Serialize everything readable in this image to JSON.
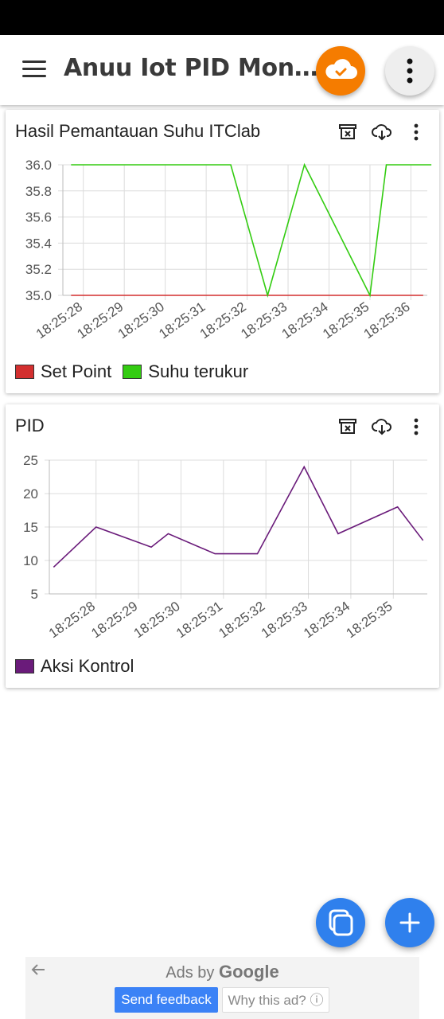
{
  "header": {
    "title": "Anuu Iot PID Mon…",
    "menu_icon": "menu-icon",
    "cloud_icon": "cloud-check-icon",
    "more_icon": "more-vert-icon",
    "accent": "#f57c00"
  },
  "cards": [
    {
      "title": "Hasil Pemantauan Suhu ITClab",
      "icons": [
        "archive-delete-icon",
        "cloud-download-icon",
        "more-vert-icon"
      ]
    },
    {
      "title": "PID",
      "icons": [
        "archive-delete-icon",
        "cloud-download-icon",
        "more-vert-icon"
      ]
    }
  ],
  "chart_data": [
    {
      "type": "line",
      "x_ticks": [
        "18:25:28",
        "18:25:29",
        "18:25:30",
        "18:25:31",
        "18:25:32",
        "18:25:33",
        "18:25:34",
        "18:25:35",
        "18:25:36"
      ],
      "y_ticks": [
        "36.0",
        "35.8",
        "35.6",
        "35.4",
        "35.2",
        "35.0"
      ],
      "ylim": [
        35.0,
        36.0
      ],
      "grid": true,
      "legend_position": "bottom",
      "series": [
        {
          "name": "Set Point",
          "color": "#d32f2f",
          "points": [
            [
              27.7,
              35.0
            ],
            [
              36.3,
              35.0
            ]
          ]
        },
        {
          "name": "Suhu terukur",
          "color": "#33cc11",
          "points": [
            [
              27.7,
              36.0
            ],
            [
              31.6,
              36.0
            ],
            [
              32.5,
              35.0
            ],
            [
              33.4,
              36.0
            ],
            [
              35.0,
              35.0
            ],
            [
              35.4,
              36.0
            ],
            [
              36.5,
              36.0
            ]
          ]
        }
      ]
    },
    {
      "type": "line",
      "x_ticks": [
        "18:25:28",
        "18:25:29",
        "18:25:30",
        "18:25:31",
        "18:25:32",
        "18:25:33",
        "18:25:34",
        "18:25:35"
      ],
      "y_ticks": [
        "25",
        "20",
        "15",
        "10",
        "5"
      ],
      "ylim": [
        5,
        25
      ],
      "grid": true,
      "legend_position": "bottom",
      "series": [
        {
          "name": "Aksi Kontrol",
          "color": "#6a1b7a",
          "points": [
            [
              27.0,
              9
            ],
            [
              28.0,
              15
            ],
            [
              29.3,
              12
            ],
            [
              29.7,
              14
            ],
            [
              30.8,
              11
            ],
            [
              31.8,
              11
            ],
            [
              32.9,
              24
            ],
            [
              33.7,
              14
            ],
            [
              35.1,
              18
            ],
            [
              35.7,
              13
            ]
          ]
        }
      ]
    }
  ],
  "fabs": {
    "copy_icon": "copy-icon",
    "add_icon": "plus-icon",
    "color": "#2f80ed"
  },
  "ad": {
    "ads_by": "Ads by",
    "google": "Google",
    "feedback": "Send feedback",
    "why": "Why this ad? ⓘ"
  }
}
